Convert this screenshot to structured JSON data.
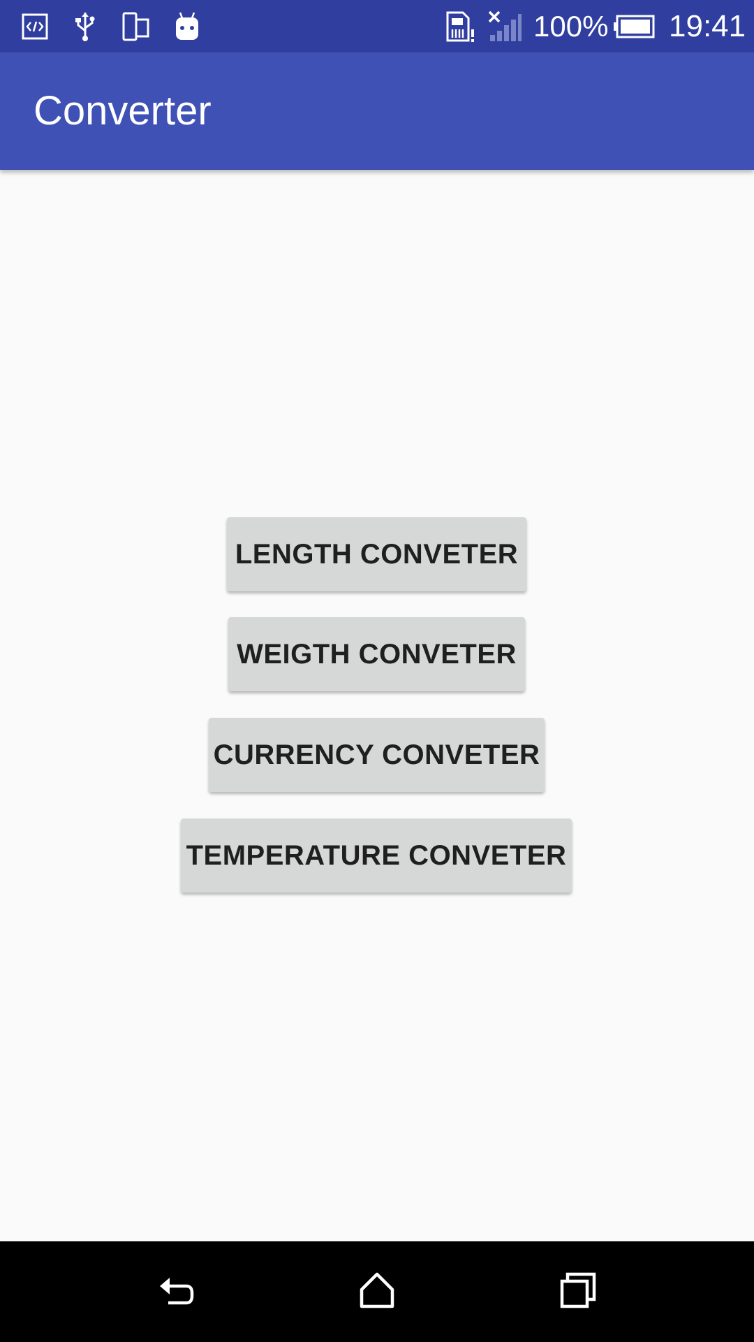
{
  "status_bar": {
    "battery_text": "100%",
    "time": "19:41",
    "icons": [
      "code-icon",
      "usb-icon",
      "device-icon",
      "android-debug-icon",
      "sim-alert-icon",
      "no-signal-icon",
      "battery-icon"
    ]
  },
  "app_bar": {
    "title": "Converter"
  },
  "main": {
    "buttons": [
      {
        "label": "LENGTH CONVETER"
      },
      {
        "label": "WEIGTH CONVETER"
      },
      {
        "label": "CURRENCY CONVETER"
      },
      {
        "label": "TEMPERATURE CONVETER"
      }
    ]
  },
  "nav_bar": {
    "icons": [
      "back-icon",
      "home-icon",
      "recents-icon"
    ]
  },
  "colors": {
    "status_bar": "#303f9f",
    "app_bar": "#3f51b5",
    "background": "#fafafa",
    "button": "#d6d7d7",
    "button_text": "#1f1f1f",
    "nav_bar": "#000000"
  }
}
